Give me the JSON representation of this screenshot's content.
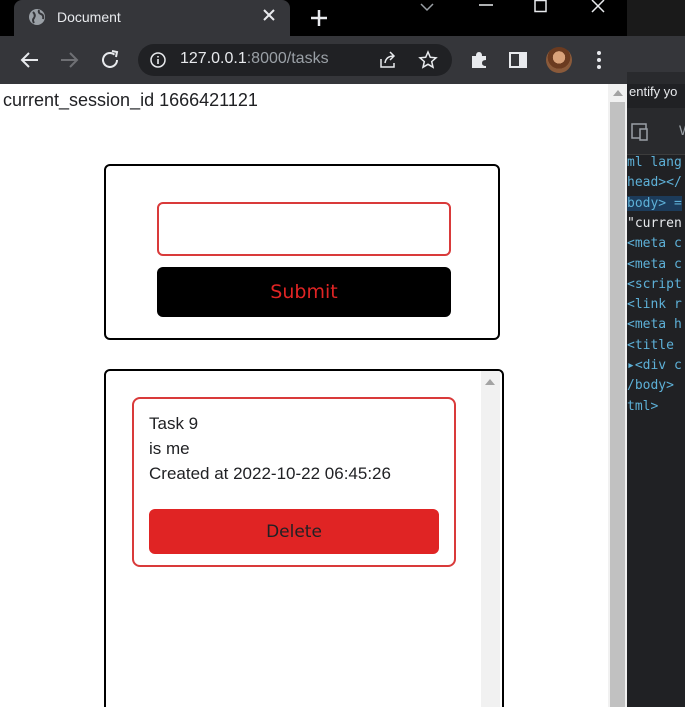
{
  "browser": {
    "tab_title": "Document",
    "url_host": "127.0.0.1",
    "url_rest": ":8000/tasks"
  },
  "page": {
    "session_text": "current_session_id 1666421121",
    "form": {
      "input_value": "",
      "submit_label": "Submit"
    },
    "tasks": [
      {
        "title": "Task 9",
        "body": "is me",
        "created": "Created at 2022-10-22 06:45:26",
        "delete_label": "Delete"
      }
    ]
  },
  "devtools": {
    "hint": "entify yo",
    "lines": [
      {
        "text": "ml lang",
        "style": "tag"
      },
      {
        "text": "head></",
        "style": "tag"
      },
      {
        "text": "body> =",
        "style": "tag-selected"
      },
      {
        "text": " \"curren",
        "style": "white"
      },
      {
        "text": " <meta c",
        "style": "tag"
      },
      {
        "text": " <meta c",
        "style": "tag"
      },
      {
        "text": " <script",
        "style": "tag"
      },
      {
        "text": " <link r",
        "style": "tag"
      },
      {
        "text": " <meta h",
        "style": "tag"
      },
      {
        "text": " <title",
        "style": "tag"
      },
      {
        "text": "▸<div c",
        "style": "tag"
      },
      {
        "text": "/body>",
        "style": "tag"
      },
      {
        "text": "tml>",
        "style": "tag"
      }
    ]
  },
  "colors": {
    "accent_red": "#e02424",
    "border_red": "#d93a3a",
    "chrome_dark": "#35363a"
  }
}
